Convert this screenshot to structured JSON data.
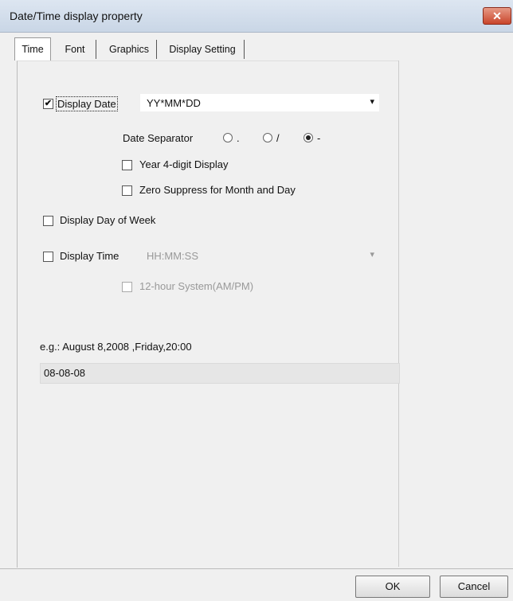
{
  "window": {
    "title": "Date/Time display property",
    "close_label": "✕"
  },
  "tabs": [
    {
      "label": "Time"
    },
    {
      "label": "Font"
    },
    {
      "label": "Graphics"
    },
    {
      "label": "Display Setting"
    }
  ],
  "display_date": {
    "label": "Display Date",
    "checked_mark": "✔",
    "format_value": "YY*MM*DD"
  },
  "date_separator": {
    "label": "Date Separator",
    "options": [
      {
        "label": "."
      },
      {
        "label": "/"
      },
      {
        "label": "-"
      }
    ],
    "selected": "-"
  },
  "year_4digit": {
    "label": "Year 4-digit Display"
  },
  "zero_suppress": {
    "label": "Zero Suppress for Month and Day"
  },
  "display_day_of_week": {
    "label": "Display Day of Week"
  },
  "display_time": {
    "label": "Display Time",
    "format_value": "HH:MM:SS"
  },
  "hour12": {
    "label": "12-hour System(AM/PM)"
  },
  "example": {
    "label": "e.g.: August 8,2008 ,Friday,20:00",
    "preview_value": "08-08-08"
  },
  "buttons": {
    "ok": "OK",
    "cancel": "Cancel"
  },
  "icons": {
    "dropdown": "▾"
  }
}
